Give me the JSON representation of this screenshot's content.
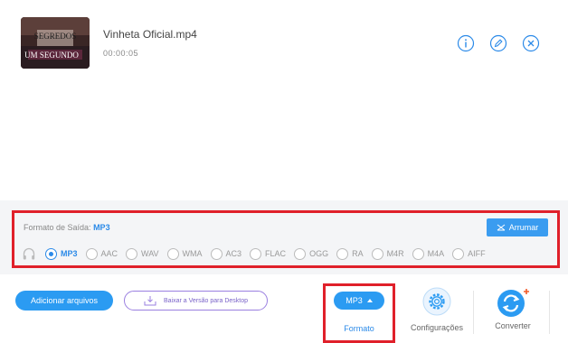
{
  "file": {
    "name": "Vinheta Oficial.mp4",
    "duration": "00:00:05",
    "thumbnail_text": [
      "SEGREDOS",
      "UM SEGUNDO"
    ]
  },
  "format_panel": {
    "label": "Formato de Saída:",
    "current": "MP3",
    "arrumar_label": "Arrumar",
    "options": [
      {
        "label": "MP3",
        "selected": true
      },
      {
        "label": "AAC",
        "selected": false
      },
      {
        "label": "WAV",
        "selected": false
      },
      {
        "label": "WMA",
        "selected": false
      },
      {
        "label": "AC3",
        "selected": false
      },
      {
        "label": "FLAC",
        "selected": false
      },
      {
        "label": "OGG",
        "selected": false
      },
      {
        "label": "RA",
        "selected": false
      },
      {
        "label": "M4R",
        "selected": false
      },
      {
        "label": "M4A",
        "selected": false
      },
      {
        "label": "AIFF",
        "selected": false
      }
    ]
  },
  "bottom_bar": {
    "add_files_label": "Adicionar arquivos",
    "desktop_label": "Baixar a Versão para Desktop",
    "format_pill": "MP3",
    "format_label": "Formato",
    "settings_label": "Configurações",
    "convert_label": "Converter"
  },
  "colors": {
    "accent": "#2b9bf2",
    "highlight": "#e0202a",
    "desktop_border": "#9a7fe0"
  },
  "icons": [
    "info-icon",
    "edit-icon",
    "close-icon",
    "headphone-icon",
    "arrumar-icon",
    "download-icon",
    "settings-gear-icon",
    "convert-icon"
  ]
}
